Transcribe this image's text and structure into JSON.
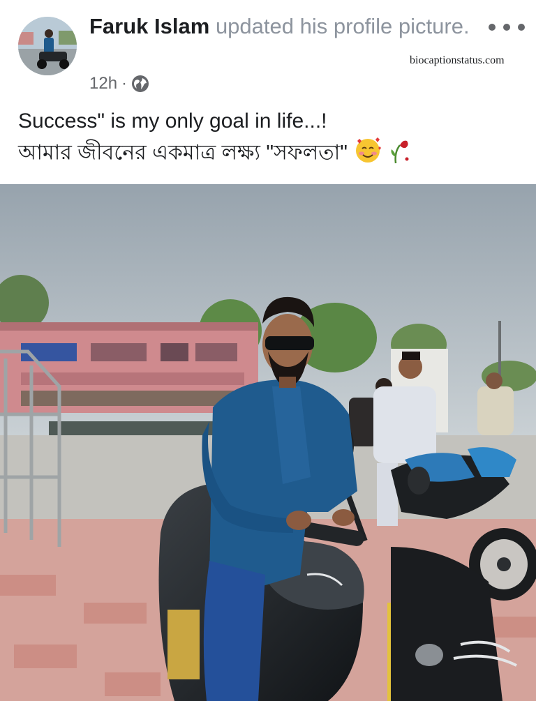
{
  "post": {
    "author": "Faruk Islam",
    "action": "updated his profile picture.",
    "time": "12h",
    "privacy_icon": "globe-icon",
    "menu_icon": "more-options-icon",
    "watermark": "biocaptionstatus.com",
    "caption_en": "Success\" is my only goal in life...!",
    "caption_bn": "আমার জীবনের একমাত্র লক্ষ্য \"সফলতা\"",
    "caption_emojis": [
      "smiling-face-with-hearts-emoji",
      "wilted-rose-emoji"
    ]
  },
  "colors": {
    "name": "#1c1e21",
    "secondary": "#65676b",
    "action": "#8d949e",
    "kurta": "#1e5a8c",
    "sky": "#aeb7c0"
  }
}
